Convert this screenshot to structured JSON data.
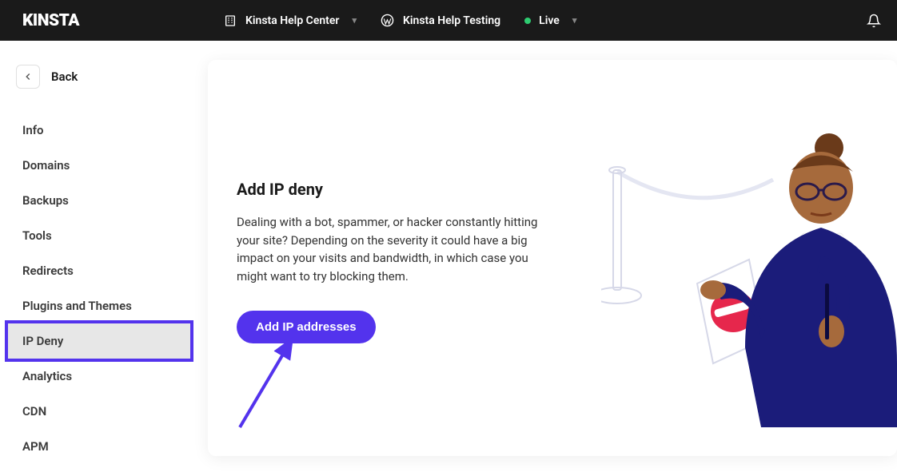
{
  "header": {
    "logo": "KINSTA",
    "company_label": "Kinsta Help Center",
    "site_label": "Kinsta Help Testing",
    "env_label": "Live"
  },
  "sidebar": {
    "back_label": "Back",
    "items": [
      {
        "label": "Info"
      },
      {
        "label": "Domains"
      },
      {
        "label": "Backups"
      },
      {
        "label": "Tools"
      },
      {
        "label": "Redirects"
      },
      {
        "label": "Plugins and Themes"
      },
      {
        "label": "IP Deny"
      },
      {
        "label": "Analytics"
      },
      {
        "label": "CDN"
      },
      {
        "label": "APM"
      }
    ],
    "active_index": 6
  },
  "main": {
    "heading": "Add IP deny",
    "description": "Dealing with a bot, spammer, or hacker constantly hitting your site? Depending on the severity it could have a big impact on your visits and bandwidth, in which case you might want to try blocking them.",
    "button_label": "Add IP addresses"
  },
  "colors": {
    "accent": "#5333ed",
    "topbar": "#1a1a1a",
    "status_live": "#2ecc71"
  }
}
